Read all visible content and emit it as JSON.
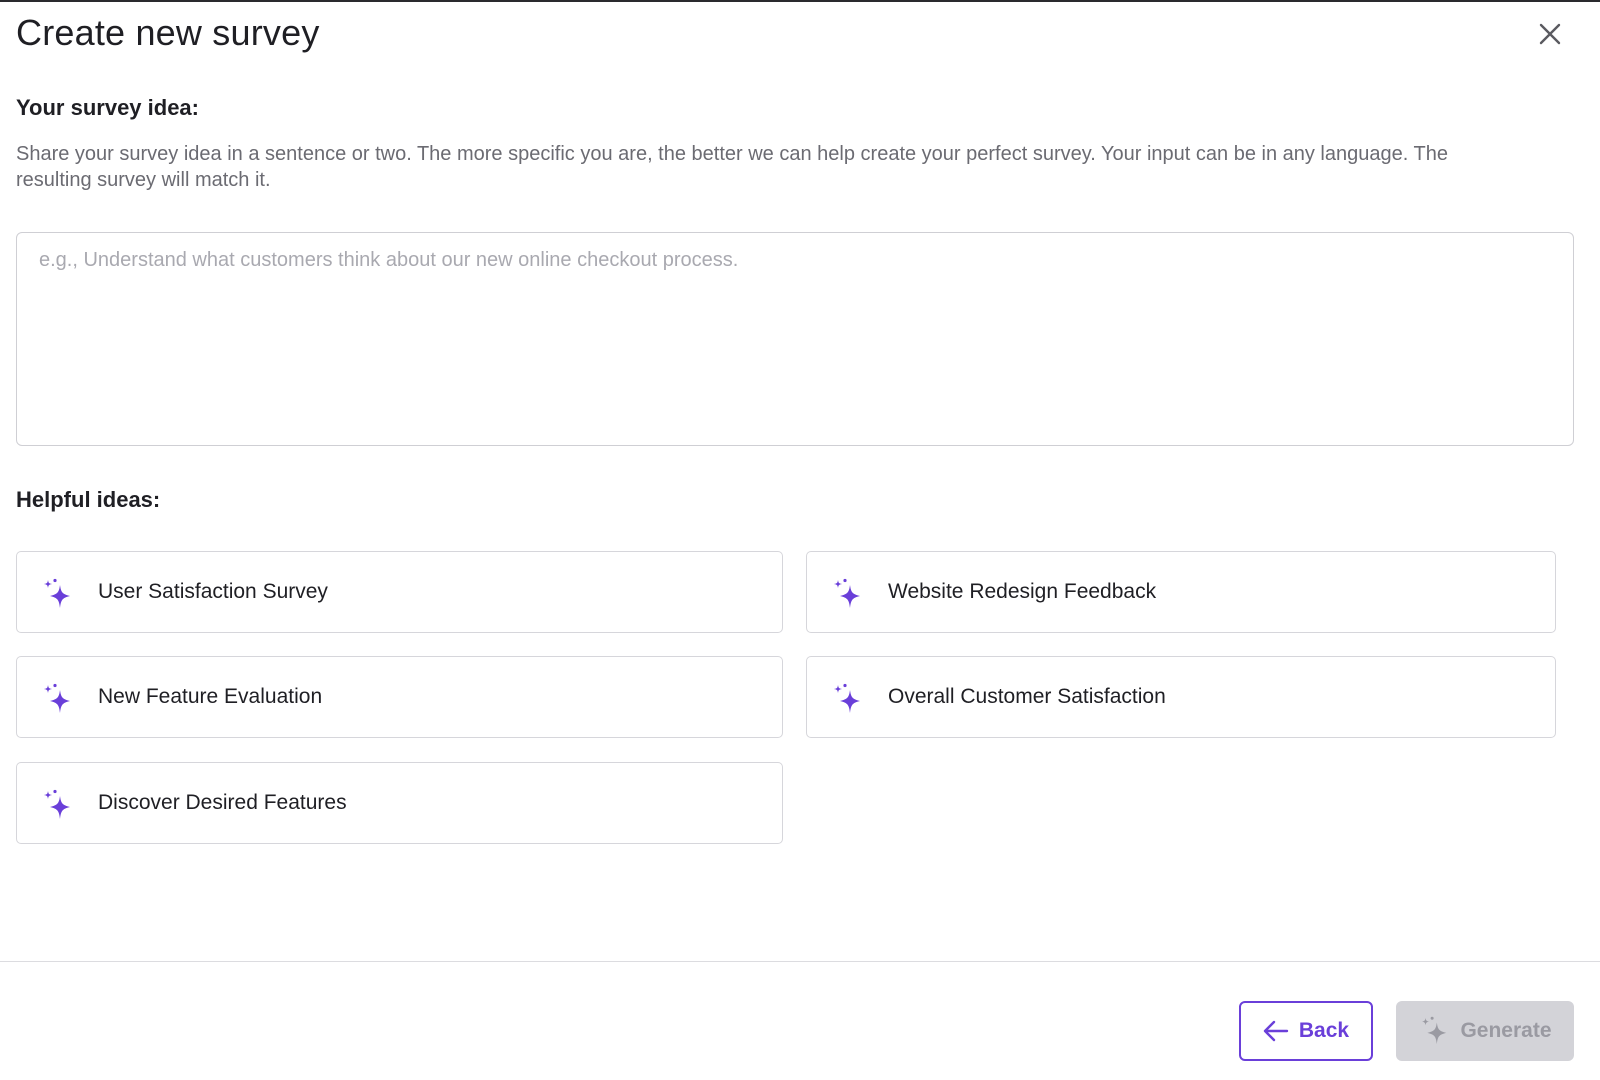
{
  "dialog": {
    "title": "Create new survey",
    "close_icon": "close-icon"
  },
  "idea_section": {
    "label": "Your survey idea:",
    "description": "Share your survey idea in a sentence or two. The more specific you are, the better we can help create your perfect survey. Your input can be in any language. The resulting survey will match it.",
    "input_value": "",
    "input_placeholder": "e.g., Understand what customers think about our new online checkout process."
  },
  "helpful_ideas": {
    "label": "Helpful ideas:",
    "icon": "sparkles-icon",
    "items": [
      {
        "label": "User Satisfaction Survey"
      },
      {
        "label": "Website Redesign Feedback"
      },
      {
        "label": "New Feature Evaluation"
      },
      {
        "label": "Overall Customer Satisfaction"
      },
      {
        "label": "Discover Desired Features"
      }
    ]
  },
  "footer": {
    "back_label": "Back",
    "back_icon": "arrow-left-icon",
    "generate_label": "Generate",
    "generate_icon": "sparkles-icon",
    "generate_disabled": true
  },
  "colors": {
    "accent": "#6a3fd9",
    "text": "#1f1f24",
    "muted_text": "#6b6b72",
    "border": "#d6d6db",
    "disabled_bg": "#d3d3d8",
    "disabled_text": "#9a9aa2"
  }
}
